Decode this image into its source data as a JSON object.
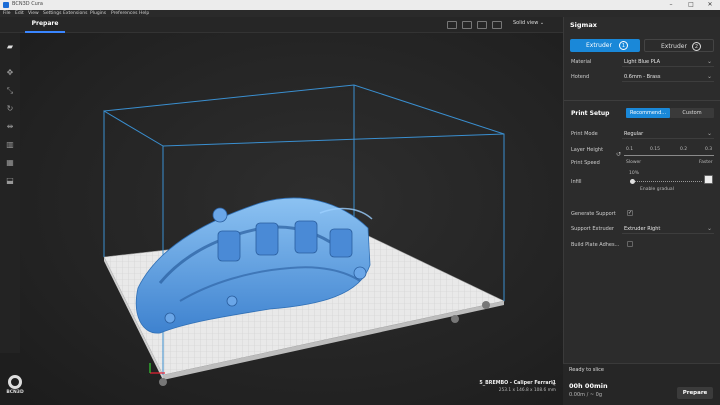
{
  "window": {
    "title": "BCN3D Cura",
    "minimize": "–",
    "maximize": "□",
    "close": "✕"
  },
  "menu": [
    "File",
    "Edit",
    "View",
    "Settings",
    "Extensions",
    "Plugins",
    "Preferences",
    "Help"
  ],
  "stage": {
    "prepare_tab": "Prepare",
    "view_mode": "Solid view"
  },
  "panel": {
    "printer_name": "Sigmax",
    "extruders": [
      {
        "label": "Extruder",
        "number": "1"
      },
      {
        "label": "Extruder",
        "number": "2"
      }
    ],
    "material": {
      "label": "Material",
      "value": "Light Blue PLA"
    },
    "hotend": {
      "label": "Hotend",
      "value": "0.6mm - Brass"
    },
    "print_setup": {
      "title": "Print Setup",
      "modes": [
        "Recommend...",
        "Custom"
      ],
      "print_mode": {
        "label": "Print Mode",
        "value": "Regular"
      },
      "layer_height": {
        "label": "Layer Height",
        "ticks": [
          "0.1",
          "0.15",
          "0.2",
          "0.3"
        ]
      },
      "print_speed": {
        "label": "Print Speed",
        "slower": "Slower",
        "faster": "Faster"
      },
      "infill": {
        "label": "Infill",
        "value": "10%",
        "enable_gradual": "Enable gradual"
      },
      "generate_support": {
        "label": "Generate Support",
        "checked": "✓"
      },
      "support_extruder": {
        "label": "Support Extruder",
        "value": "Extruder Right"
      },
      "build_plate": {
        "label": "Build Plate Adhes..."
      }
    }
  },
  "bottom": {
    "status": "Ready to slice",
    "time": "00h 00min",
    "material_usage": "0.00m / ~ 0g",
    "prepare_button": "Prepare"
  },
  "model": {
    "name": "5_BREMBO - Caliper Ferrari1",
    "dimensions": "253.1 x 146.8 x 108.6 mm"
  },
  "logo": {
    "text": "BCN3D"
  },
  "colors": {
    "accent": "#1a88d8",
    "model": "#5a9fe0",
    "build_volume": "#3a8fd0"
  }
}
